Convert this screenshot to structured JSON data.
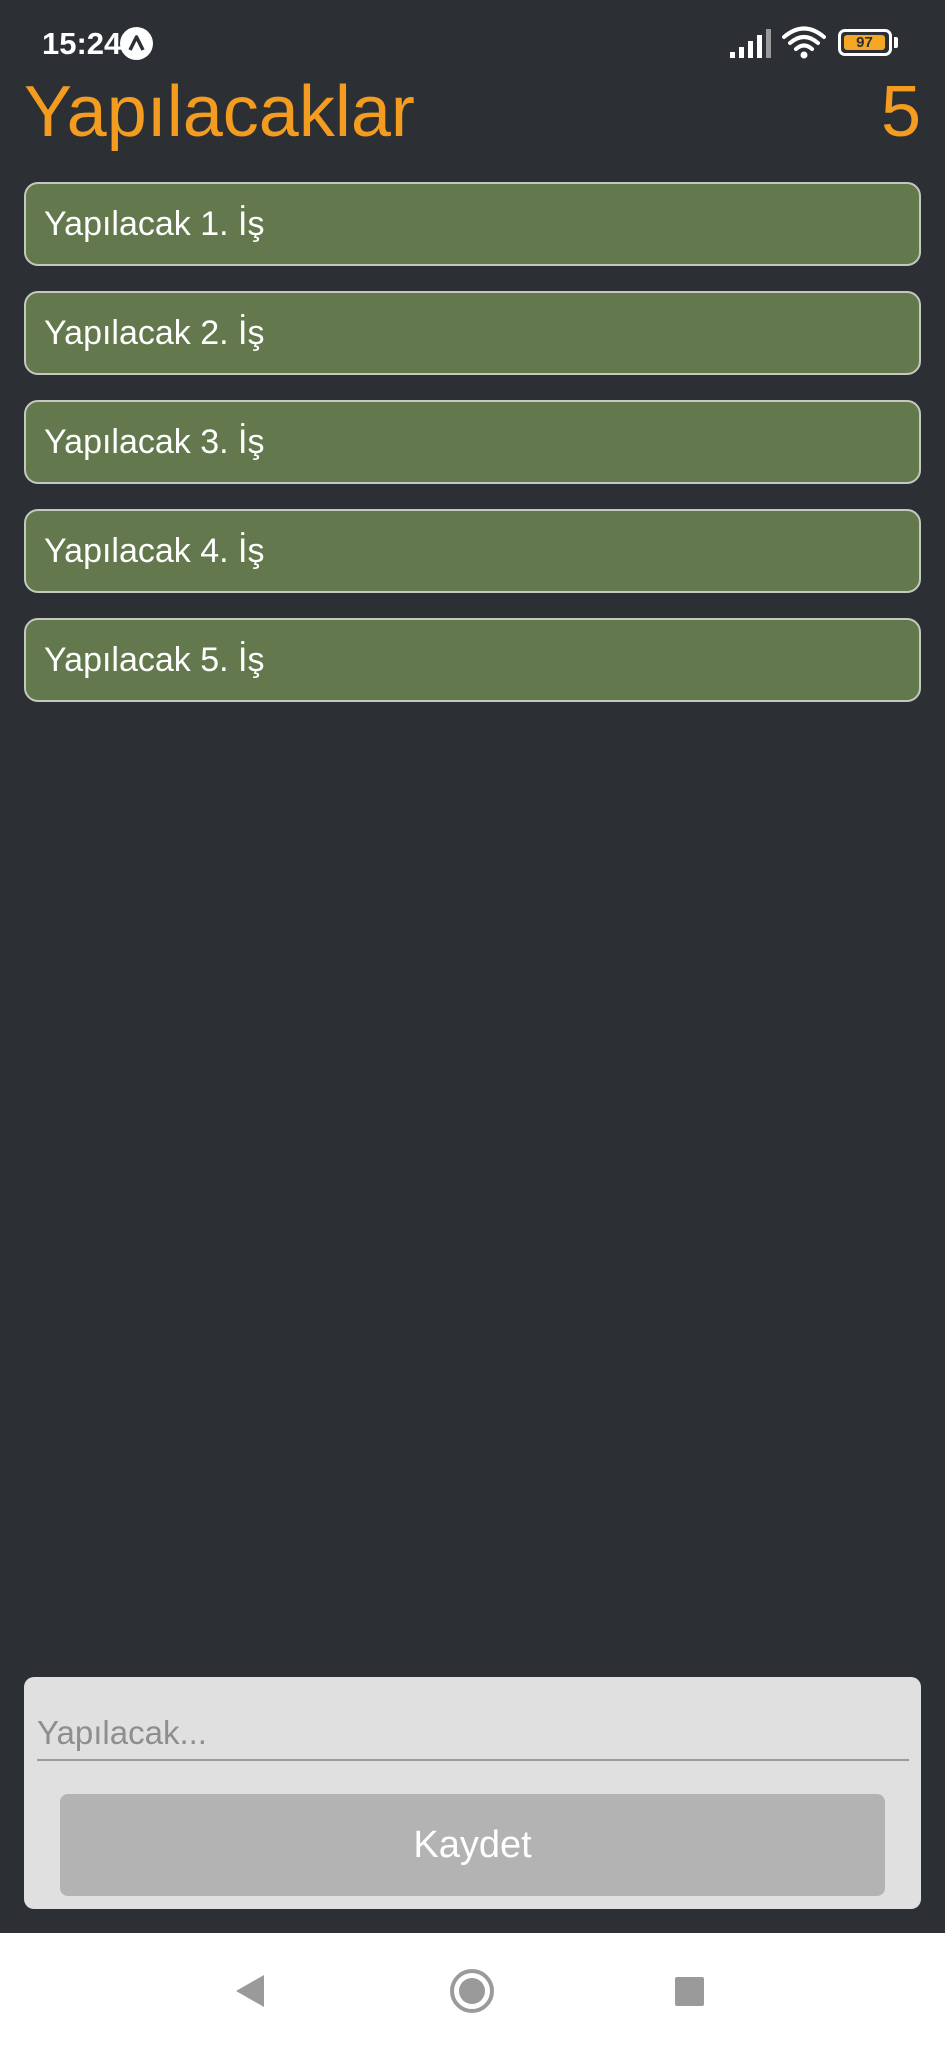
{
  "status_bar": {
    "time": "15:24",
    "battery": "97",
    "icons": [
      "app-notification-icon",
      "signal-icon",
      "wifi-icon",
      "battery-icon"
    ]
  },
  "header": {
    "title": "Yapılacaklar",
    "count": "5"
  },
  "todos": [
    {
      "label": "Yapılacak 1. İş"
    },
    {
      "label": "Yapılacak 2. İş"
    },
    {
      "label": "Yapılacak 3. İş"
    },
    {
      "label": "Yapılacak 4. İş"
    },
    {
      "label": "Yapılacak 5. İş"
    }
  ],
  "input": {
    "placeholder": "Yapılacak...",
    "value": ""
  },
  "save_button": {
    "label": "Kaydet"
  },
  "nav": {
    "icons": [
      "back-icon",
      "home-icon",
      "recents-icon"
    ]
  },
  "colors": {
    "background": "#2c3034",
    "accent": "#f39c1f",
    "item_background": "#63784c",
    "panel_background": "#e0e0e0",
    "button_background": "#b3b3b3"
  }
}
